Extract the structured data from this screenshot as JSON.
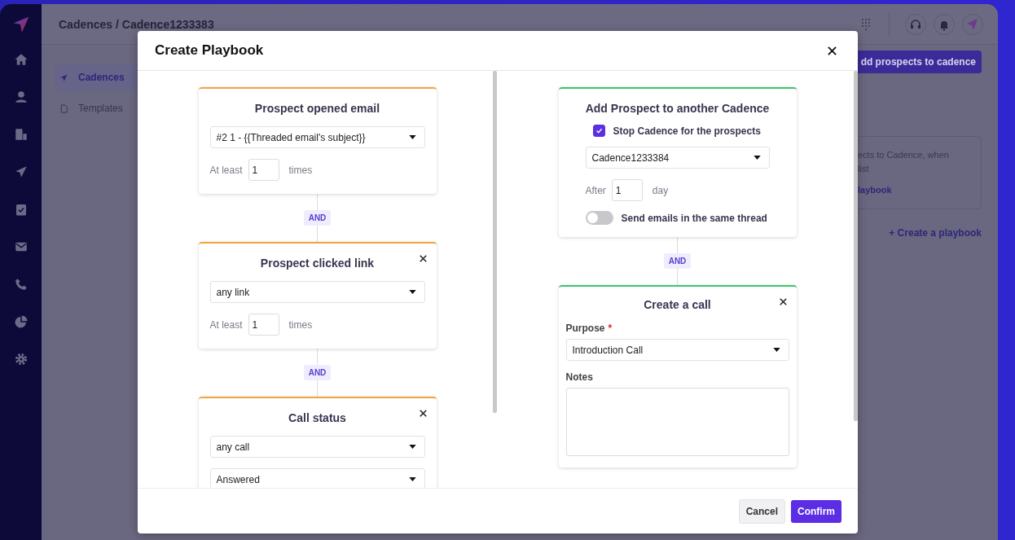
{
  "header": {
    "breadcrumb": "Cadences / Cadence1233383"
  },
  "subnav": {
    "items": [
      {
        "label": "Cadences",
        "selected": true
      },
      {
        "label": "Templates",
        "selected": false
      }
    ]
  },
  "background_panel": {
    "button": "dd prospects to cadence",
    "card_lines": [
      "ects to Cadence, when",
      "list"
    ],
    "card_link": "laybook",
    "create_link": "+ Create a playbook"
  },
  "modal": {
    "title": "Create Playbook",
    "triggers": [
      {
        "title": "Prospect opened email",
        "closable": false,
        "fields": [
          {
            "kind": "select",
            "value": "#2 1 - {{Threaded email's subject}}"
          },
          {
            "kind": "count",
            "prefix": "At least",
            "value": "1",
            "suffix": "times"
          }
        ]
      },
      {
        "connector": "AND",
        "title": "Prospect clicked link",
        "closable": true,
        "fields": [
          {
            "kind": "select",
            "value": "any link"
          },
          {
            "kind": "count",
            "prefix": "At least",
            "value": "1",
            "suffix": "times"
          }
        ]
      },
      {
        "connector": "AND",
        "title": "Call status",
        "closable": true,
        "fields": [
          {
            "kind": "select",
            "value": "any call"
          },
          {
            "kind": "select",
            "value": "Answered"
          }
        ]
      }
    ],
    "actions": [
      {
        "title": "Add Prospect to another Cadence",
        "closable": false,
        "fields": [
          {
            "kind": "checkbox",
            "label": "Stop Cadence for the prospects",
            "checked": true
          },
          {
            "kind": "select",
            "value": "Cadence1233384"
          },
          {
            "kind": "count",
            "prefix": "After",
            "value": "1",
            "suffix": "day"
          },
          {
            "kind": "toggle",
            "label": "Send emails in the same thread",
            "on": false
          }
        ]
      },
      {
        "connector": "AND",
        "title": "Create a call",
        "closable": true,
        "fields": [
          {
            "kind": "select",
            "label": "Purpose",
            "required_mark": "*",
            "value": "Introduction Call"
          },
          {
            "kind": "textarea",
            "label": "Notes"
          }
        ]
      }
    ],
    "buttons": [
      {
        "label": "Cancel",
        "kind": "secondary"
      },
      {
        "label": "Confirm",
        "kind": "primary"
      }
    ]
  }
}
